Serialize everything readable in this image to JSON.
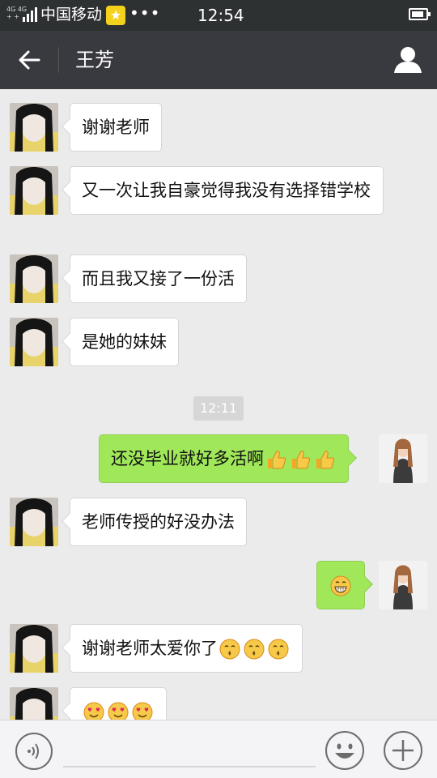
{
  "status_bar": {
    "network_top": "4G 4G",
    "network_bottom": "+ +",
    "carrier": "中国移动",
    "badge_icon": "star-badge-icon",
    "more": "•••",
    "time": "12:54",
    "battery_level": 0.9
  },
  "nav": {
    "back_icon": "arrow-left-icon",
    "title": "王芳",
    "profile_icon": "person-icon"
  },
  "messages": [
    {
      "side": "left",
      "text": "谢谢老师"
    },
    {
      "side": "left",
      "text": "又一次让我自豪觉得我没有选择错学校"
    },
    {
      "side": "left",
      "text": "而且我又接了一份活"
    },
    {
      "side": "left",
      "text": "是她的妹妹"
    },
    {
      "side": "timestamp",
      "text": "12:11"
    },
    {
      "side": "right",
      "text": "还没毕业就好多活啊",
      "emoji": [
        "thumbs-up-icon",
        "thumbs-up-icon",
        "thumbs-up-icon"
      ]
    },
    {
      "side": "left",
      "text": "老师传授的好没办法"
    },
    {
      "side": "right",
      "text": "",
      "emoji": [
        "grin-icon"
      ]
    },
    {
      "side": "left",
      "text": "谢谢老师太爱你了",
      "emoji": [
        "kiss-face-icon",
        "kiss-face-icon",
        "kiss-face-icon"
      ]
    },
    {
      "side": "left",
      "text": "",
      "emoji": [
        "heart-eyes-icon",
        "heart-eyes-icon",
        "heart-eyes-icon"
      ]
    }
  ],
  "input_bar": {
    "voice_icon": "voice-icon",
    "sticker_icon": "smiley-icon",
    "more_icon": "plus-icon"
  },
  "colors": {
    "status_bar_bg": "#2e3132",
    "nav_bg": "#393a3f",
    "chat_bg": "#ebebeb",
    "bubble_self": "#a0e75a",
    "bubble_other": "#ffffff"
  }
}
